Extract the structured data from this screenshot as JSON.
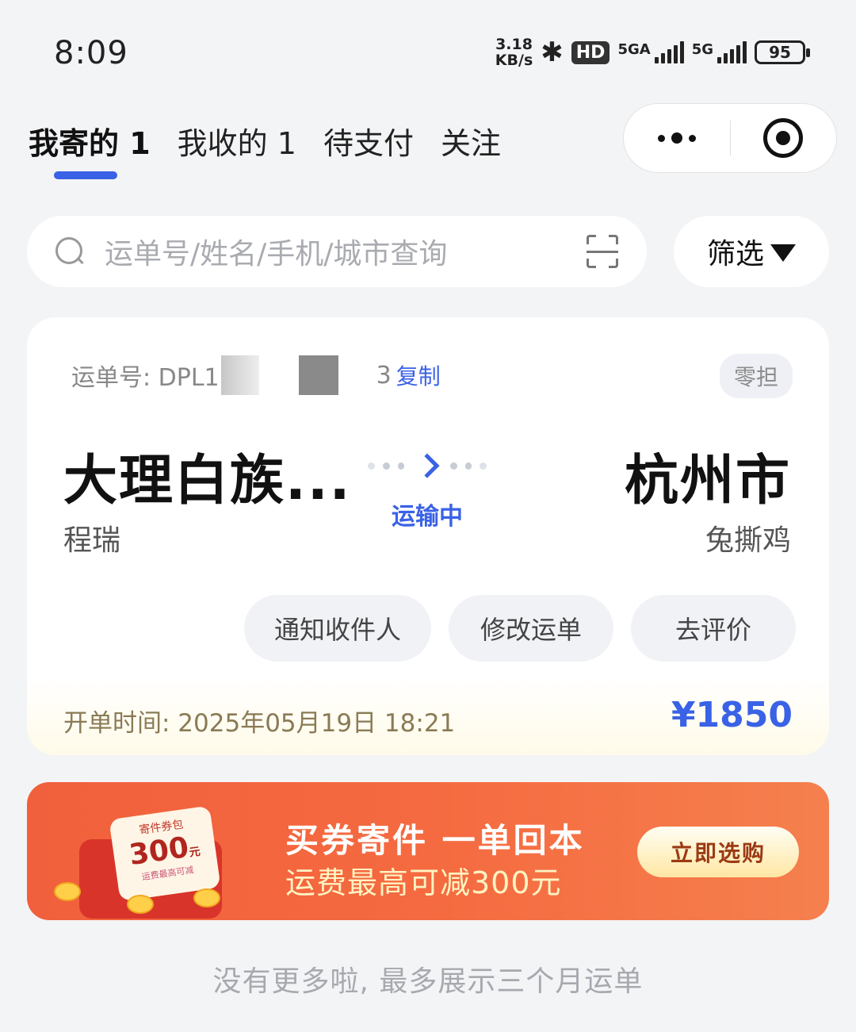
{
  "status_bar": {
    "time": "8:09",
    "net_speed_value": "3.18",
    "net_speed_unit": "KB/s",
    "hd_label": "HD",
    "signal1_label": "5GA",
    "signal2_label": "5G",
    "battery": "95"
  },
  "tabs": [
    {
      "label": "我寄的 1",
      "active": true
    },
    {
      "label": "我收的 1",
      "active": false
    },
    {
      "label": "待支付",
      "active": false
    },
    {
      "label": "关注",
      "active": false
    }
  ],
  "search": {
    "placeholder": "运单号/姓名/手机/城市查询"
  },
  "filter": {
    "label": "筛选"
  },
  "order": {
    "waybill_label": "运单号: DPL1",
    "waybill_tail": "3",
    "copy_label": "复制",
    "type_badge": "零担",
    "origin_city": "大理白族...",
    "sender_name": "程瑞",
    "destination_city": "杭州市",
    "receiver_name": "兔撕鸡",
    "status": "运输中",
    "actions": [
      "通知收件人",
      "修改运单",
      "去评价"
    ],
    "open_time": "开单时间: 2025年05月19日 18:21",
    "price": "¥1850",
    "accent_color": "#3a62e6"
  },
  "banner": {
    "coupon_name": "寄件券包",
    "coupon_amount": "300",
    "coupon_unit": "元",
    "coupon_sub": "运费最高可减",
    "title": "买券寄件 一单回本",
    "subtitle": "运费最高可减300元",
    "button": "立即选购"
  },
  "footer_note": "没有更多啦, 最多展示三个月运单"
}
